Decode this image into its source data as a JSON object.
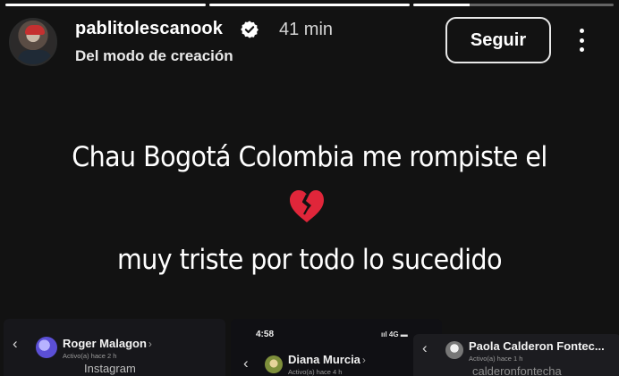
{
  "story": {
    "progress": [
      1,
      1,
      0.28
    ],
    "header": {
      "username": "pablitolescanook",
      "time": "41 min",
      "subtitle": "Del modo de creación",
      "follow_label": "Seguir",
      "icons": {
        "verified": "verified-badge-icon",
        "more": "more-options-icon"
      }
    },
    "text": {
      "line1": "Chau Bogotá Colombia me rompiste el",
      "emoji": "broken-heart-icon",
      "line3": "muy triste por todo lo sucedido"
    }
  },
  "chats": [
    {
      "name": "Roger Malagon",
      "status": "Activo(a) hace 2 h",
      "extra": "Instagram"
    },
    {
      "phone_time": "4:58",
      "signal": "4G",
      "name": "Diana Murcia",
      "status": "Activo(a) hace 4 h"
    },
    {
      "name": "Paola Calderon Fontec...",
      "status": "Activo(a) hace 1 h",
      "extra": "calderonfontecha"
    }
  ],
  "colors": {
    "background": "#121212",
    "text": "#ffffff",
    "broken_heart": "#e0263a"
  }
}
